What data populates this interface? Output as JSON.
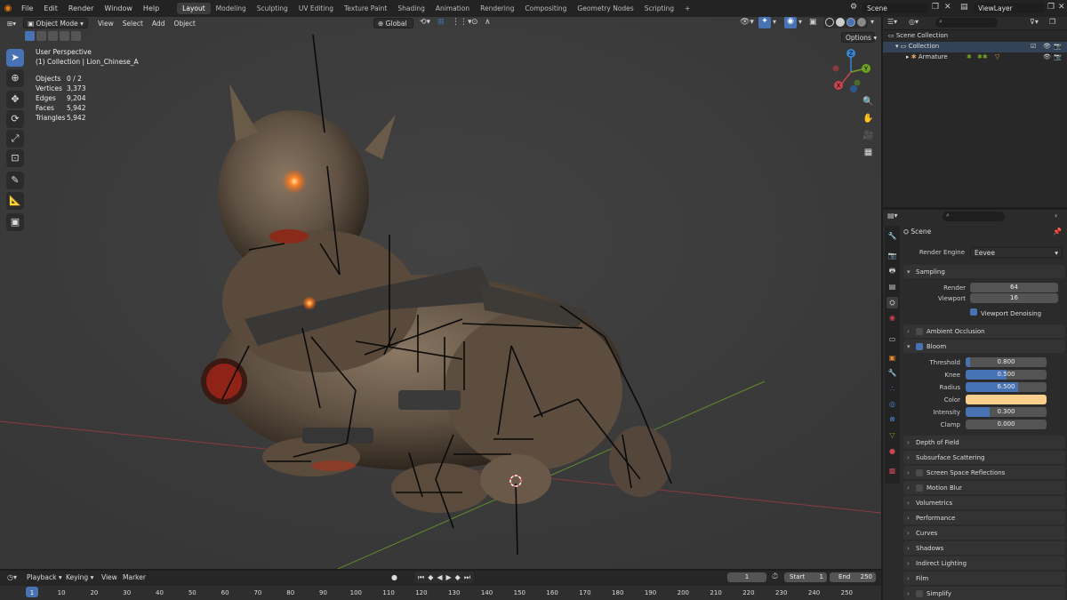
{
  "topbar": {
    "menus": [
      "File",
      "Edit",
      "Render",
      "Window",
      "Help"
    ],
    "workspaces": [
      "Layout",
      "Modeling",
      "Sculpting",
      "UV Editing",
      "Texture Paint",
      "Shading",
      "Animation",
      "Rendering",
      "Compositing",
      "Geometry Nodes",
      "Scripting"
    ],
    "active_workspace": "Layout",
    "add_tab": "+",
    "scene": "Scene",
    "view_layer": "ViewLayer"
  },
  "viewport": {
    "mode": "Object Mode",
    "menus": [
      "View",
      "Select",
      "Add",
      "Object"
    ],
    "transform": "Global",
    "options": "Options",
    "perspective": "User Perspective",
    "collection_info": "(1) Collection | Lion_Chinese_A",
    "stats": [
      {
        "label": "Objects",
        "value": "0 / 2"
      },
      {
        "label": "Vertices",
        "value": "3,373"
      },
      {
        "label": "Edges",
        "value": "9,204"
      },
      {
        "label": "Faces",
        "value": "5,942"
      },
      {
        "label": "Triangles",
        "value": "5,942"
      }
    ],
    "gizmo": {
      "x": "X",
      "y": "Y",
      "z": "Z"
    }
  },
  "outliner": {
    "root": "Scene Collection",
    "collection": "Collection",
    "armature": "Armature"
  },
  "properties": {
    "scene_label": "Scene",
    "render_engine_label": "Render Engine",
    "render_engine": "Eevee",
    "sampling": "Sampling",
    "render_label": "Render",
    "render_value": "64",
    "viewport_label": "Viewport",
    "viewport_value": "16",
    "viewport_denoising": "Viewport Denoising",
    "ambient_occlusion": "Ambient Occlusion",
    "bloom": "Bloom",
    "threshold_label": "Threshold",
    "threshold": "0.800",
    "knee_label": "Knee",
    "knee": "0.500",
    "radius_label": "Radius",
    "radius": "6.500",
    "color_label": "Color",
    "bloom_color": "#f9cf8e",
    "intensity_label": "Intensity",
    "intensity": "0.300",
    "clamp_label": "Clamp",
    "clamp": "0.000",
    "panels": [
      "Depth of Field",
      "Subsurface Scattering",
      "Screen Space Reflections",
      "Motion Blur",
      "Volumetrics",
      "Performance",
      "Curves",
      "Shadows",
      "Indirect Lighting",
      "Film",
      "Simplify"
    ]
  },
  "timeline": {
    "menus": [
      "Playback",
      "Keying",
      "View",
      "Marker"
    ],
    "current_frame": "1",
    "start_label": "Start",
    "start": "1",
    "end_label": "End",
    "end": "250",
    "ticks": [
      "1",
      "10",
      "20",
      "30",
      "40",
      "50",
      "60",
      "70",
      "80",
      "90",
      "100",
      "110",
      "120",
      "130",
      "140",
      "150",
      "160",
      "170",
      "180",
      "190",
      "200",
      "210",
      "220",
      "230",
      "240",
      "250"
    ]
  },
  "colors": {
    "accent": "#4772b3",
    "viewport_bg": "#3c3c3c",
    "axis_x": "#c8454f",
    "axis_y": "#6fa324",
    "axis_z": "#3a84d1"
  }
}
